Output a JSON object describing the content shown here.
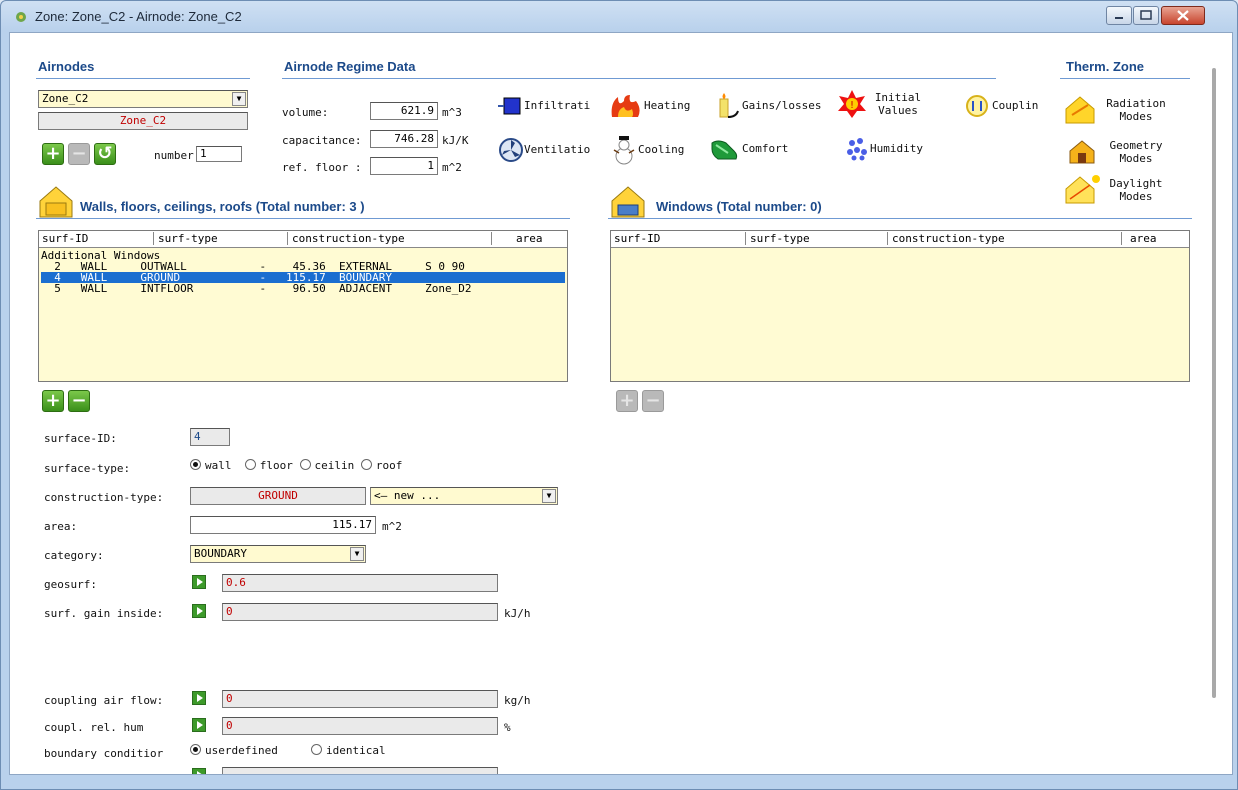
{
  "window": {
    "title": "Zone: Zone_C2  -  Airnode: Zone_C2"
  },
  "airnodes": {
    "header": "Airnodes",
    "selected": "Zone_C2",
    "name_display": "Zone_C2",
    "number_label": "number:",
    "number_value": "1"
  },
  "regime": {
    "header": "Airnode Regime Data",
    "volume_label": "volume:",
    "volume_value": "621.9",
    "volume_unit": "m^3",
    "capacitance_label": "capacitance:",
    "capacitance_value": "746.28",
    "capacitance_unit": "kJ/K",
    "ref_floor_label": "ref. floor :",
    "ref_floor_value": "1",
    "ref_floor_unit": "m^2"
  },
  "tools": {
    "infiltration": "Infiltrati",
    "heating": "Heating",
    "gains": "Gains/losses",
    "initial": "Initial Values",
    "coupling": "Couplin",
    "ventilation": "Ventilatio",
    "cooling": "Cooling",
    "comfort": "Comfort",
    "humidity": "Humidity"
  },
  "therm": {
    "header": "Therm. Zone",
    "radiation": "Radiation Modes",
    "geometry": "Geometry Modes",
    "daylight": "Daylight Modes"
  },
  "walls": {
    "header": "Walls, floors, ceilings, roofs (Total number: 3 )",
    "columns": [
      "surf-ID",
      "surf-type",
      "construction-type",
      "area"
    ],
    "rows": [
      "Additional Windows",
      "  2   WALL     OUTWALL           -    45.36  EXTERNAL     S_0_90",
      "  4   WALL     GROUND            -   115.17  BOUNDARY",
      "  5   WALL     INTFLOOR          -    96.50  ADJACENT     Zone_D2"
    ]
  },
  "windows": {
    "header": "Windows (Total number: 0)",
    "columns": [
      "surf-ID",
      "surf-type",
      "construction-type",
      "area"
    ]
  },
  "form": {
    "surface_id_label": "surface-ID:",
    "surface_id": "4",
    "surface_type_label": "surface-type:",
    "types": [
      "wall",
      "floor",
      "ceilin",
      "roof"
    ],
    "construction_label": "construction-type:",
    "construction": "GROUND",
    "construction_select": "<— new ...",
    "area_label": "area:",
    "area": "115.17",
    "area_unit": "m^2",
    "category_label": "category:",
    "category": "BOUNDARY",
    "geosurf_label": "geosurf:",
    "geosurf": "0.6",
    "gain_label": "surf. gain inside:",
    "gain": "0",
    "gain_unit": "kJ/h",
    "airflow_label": "coupling air flow:",
    "airflow": "0",
    "airflow_unit": "kg/h",
    "hum_label": "coupl. rel. hum",
    "hum": "0",
    "hum_unit": "%",
    "bc_label": "boundary conditior",
    "bc_options": [
      "userdefined",
      "identical"
    ]
  },
  "colors": {
    "header": "#1c4a8a",
    "selection": "#1b6ed0",
    "list_bg": "#fffbd3",
    "red_text": "#c00000"
  }
}
